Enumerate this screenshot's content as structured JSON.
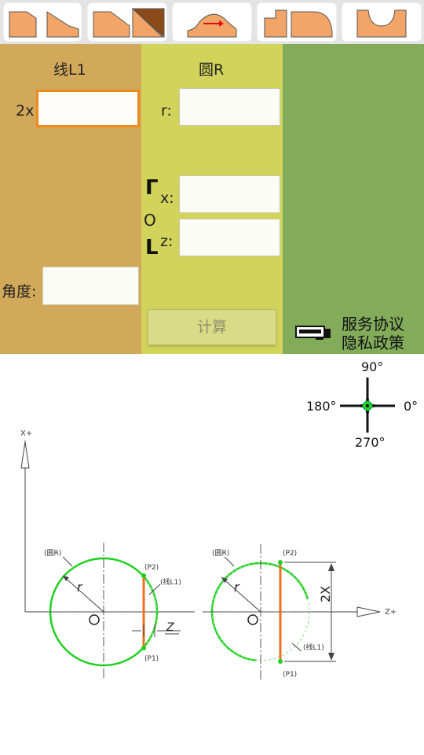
{
  "toolbar": {
    "shapes": [
      "chamfer-shape",
      "taper-shape",
      "arc-shape",
      "step-round-shape",
      "groove-shape"
    ]
  },
  "line_panel": {
    "title": "线L1",
    "x2_label": "2x",
    "x2_value": "",
    "angle_label": "角度:",
    "angle_value": ""
  },
  "circle_panel": {
    "title": "圆R",
    "r_label": "r:",
    "r_value": "",
    "center_x_label": "x:",
    "center_x_value": "",
    "center_z_label": "z:",
    "center_z_value": "",
    "center_mark": "O",
    "bracket_top": "Γ",
    "bracket_bottom": "L",
    "calc_label": "计算"
  },
  "right_panel": {
    "terms_link": "服务协议",
    "privacy_link": "隐私政策"
  },
  "compass": {
    "deg_90": "90°",
    "deg_180": "180°",
    "deg_0": "0°",
    "deg_270": "270°"
  },
  "diagram_labels": {
    "x_axis": "X+",
    "z_axis": "Z+",
    "circle_r": "(圆R)",
    "line_l1": "(线L1)",
    "p1": "(P1)",
    "p2": "(P2)",
    "r": "r",
    "origin": "O",
    "z": "Z",
    "two_x": "2X"
  },
  "colors": {
    "line_panel": "#d2a95a",
    "circle_panel": "#d1d35a",
    "right_panel": "#82ab5a",
    "circle": "#1fd11f",
    "line": "#f07020",
    "focus": "#f08a1c"
  }
}
